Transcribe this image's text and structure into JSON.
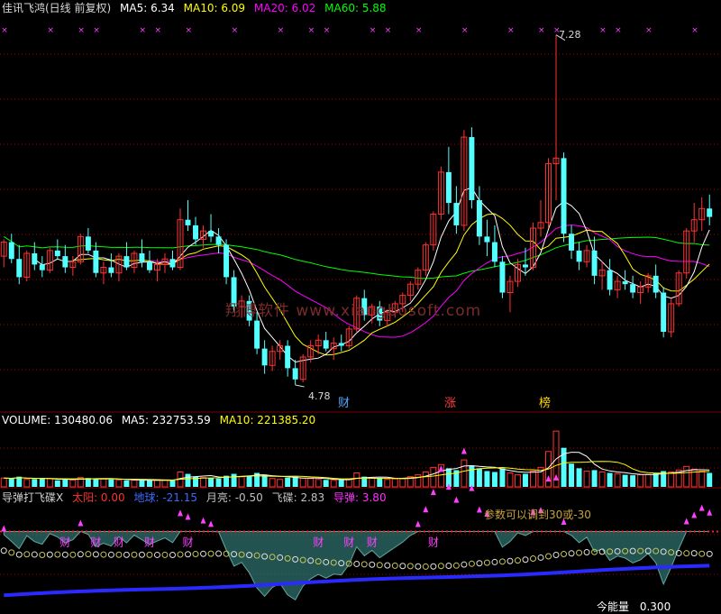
{
  "header": {
    "title": "佳讯飞鸿(日线 前复权)",
    "ma5": "MA5: 6.34",
    "ma10": "MA10: 6.09",
    "ma20": "MA20: 6.02",
    "ma60": "MA60: 5.88"
  },
  "volume_header": {
    "label": "VOLUME: 130480.06",
    "ma5": "MA5: 232753.59",
    "ma10": "MA10: 221385.20"
  },
  "indicator_header": {
    "name": "导弹打飞碟X",
    "sun": "太阳: 0.00",
    "earth": "地球: -21.15",
    "moon": "月亮: -0.50",
    "ufo": "飞碟: 2.83",
    "missile": "导弹: 3.80"
  },
  "annotations": {
    "high_price": "7.28",
    "low_price": "4.78",
    "badge_cai": "财",
    "badge_zhang": "涨",
    "badge_bang": "榜",
    "param_note": "参数可以调到30或-30",
    "energy_label": "今能量",
    "energy_value": "0.300",
    "watermark": "翔博软件 www.xiangbosoft.com",
    "cai_marker": "财"
  },
  "colors": {
    "up": "#ff3232",
    "down": "#54ffff",
    "ma5": "#ffffff",
    "ma10": "#ffff00",
    "ma20": "#ff00ff",
    "ma60": "#00ff00",
    "grid": "#b00000",
    "blue_line": "#2a2aff"
  },
  "chart_data": {
    "type": "candlestick",
    "price_range": [
      4.6,
      7.4
    ],
    "candles": [
      [
        5.7,
        5.82,
        5.62,
        5.8
      ],
      [
        5.8,
        5.86,
        5.65,
        5.68
      ],
      [
        5.68,
        5.78,
        5.5,
        5.55
      ],
      [
        5.55,
        5.74,
        5.52,
        5.72
      ],
      [
        5.72,
        5.8,
        5.6,
        5.64
      ],
      [
        5.64,
        5.7,
        5.55,
        5.6
      ],
      [
        5.6,
        5.76,
        5.58,
        5.74
      ],
      [
        5.74,
        5.82,
        5.68,
        5.7
      ],
      [
        5.7,
        5.78,
        5.58,
        5.62
      ],
      [
        5.62,
        5.7,
        5.56,
        5.66
      ],
      [
        5.66,
        5.86,
        5.64,
        5.84
      ],
      [
        5.84,
        5.9,
        5.72,
        5.74
      ],
      [
        5.74,
        5.8,
        5.55,
        5.58
      ],
      [
        5.58,
        5.66,
        5.5,
        5.62
      ],
      [
        5.62,
        5.72,
        5.55,
        5.58
      ],
      [
        5.58,
        5.72,
        5.52,
        5.7
      ],
      [
        5.7,
        5.8,
        5.6,
        5.62
      ],
      [
        5.62,
        5.74,
        5.58,
        5.72
      ],
      [
        5.72,
        5.82,
        5.62,
        5.66
      ],
      [
        5.66,
        5.74,
        5.58,
        5.6
      ],
      [
        5.6,
        5.68,
        5.52,
        5.64
      ],
      [
        5.64,
        5.72,
        5.58,
        5.68
      ],
      [
        5.68,
        5.74,
        5.6,
        5.62
      ],
      [
        5.62,
        6.04,
        5.6,
        5.96
      ],
      [
        5.96,
        6.1,
        5.88,
        5.92
      ],
      [
        5.92,
        5.98,
        5.78,
        5.82
      ],
      [
        5.82,
        5.92,
        5.76,
        5.88
      ],
      [
        5.88,
        6.0,
        5.8,
        5.84
      ],
      [
        5.84,
        5.9,
        5.72,
        5.78
      ],
      [
        5.78,
        5.82,
        5.5,
        5.55
      ],
      [
        5.55,
        5.6,
        5.3,
        5.34
      ],
      [
        5.34,
        5.42,
        5.26,
        5.38
      ],
      [
        5.38,
        5.42,
        5.2,
        5.24
      ],
      [
        5.24,
        5.3,
        5.0,
        5.04
      ],
      [
        5.04,
        5.1,
        4.86,
        4.92
      ],
      [
        4.92,
        5.06,
        4.88,
        5.02
      ],
      [
        5.02,
        5.1,
        4.96,
        5.06
      ],
      [
        5.06,
        5.1,
        4.84,
        4.9
      ],
      [
        4.9,
        4.96,
        4.78,
        4.82
      ],
      [
        4.82,
        5.0,
        4.8,
        4.98
      ],
      [
        4.98,
        5.1,
        4.94,
        5.06
      ],
      [
        5.06,
        5.14,
        5.0,
        5.1
      ],
      [
        5.1,
        5.16,
        5.02,
        5.04
      ],
      [
        5.04,
        5.12,
        4.96,
        5.08
      ],
      [
        5.08,
        5.14,
        5.02,
        5.06
      ],
      [
        5.06,
        5.2,
        5.04,
        5.18
      ],
      [
        5.18,
        5.42,
        5.16,
        5.4
      ],
      [
        5.4,
        5.46,
        5.24,
        5.28
      ],
      [
        5.28,
        5.36,
        5.22,
        5.34
      ],
      [
        5.34,
        5.38,
        5.2,
        5.24
      ],
      [
        5.24,
        5.32,
        5.2,
        5.3
      ],
      [
        5.3,
        5.38,
        5.26,
        5.36
      ],
      [
        5.36,
        5.44,
        5.3,
        5.42
      ],
      [
        5.42,
        5.52,
        5.38,
        5.5
      ],
      [
        5.5,
        5.62,
        5.46,
        5.6
      ],
      [
        5.6,
        5.8,
        5.56,
        5.78
      ],
      [
        5.78,
        6.02,
        5.74,
        6.0
      ],
      [
        6.0,
        6.34,
        5.96,
        6.3
      ],
      [
        6.3,
        6.48,
        6.0,
        6.08
      ],
      [
        6.08,
        6.2,
        5.86,
        5.92
      ],
      [
        5.92,
        6.6,
        5.88,
        6.55
      ],
      [
        6.55,
        6.62,
        6.04,
        6.1
      ],
      [
        6.1,
        6.2,
        5.78,
        5.84
      ],
      [
        5.84,
        5.96,
        5.7,
        5.8
      ],
      [
        5.8,
        5.92,
        5.62,
        5.66
      ],
      [
        5.66,
        5.7,
        5.4,
        5.44
      ],
      [
        5.44,
        5.56,
        5.3,
        5.52
      ],
      [
        5.52,
        5.68,
        5.48,
        5.64
      ],
      [
        5.64,
        5.76,
        5.56,
        5.62
      ],
      [
        5.62,
        5.94,
        5.6,
        5.9
      ],
      [
        5.9,
        6.1,
        5.84,
        5.94
      ],
      [
        5.94,
        6.4,
        5.9,
        6.36
      ],
      [
        6.36,
        7.28,
        6.1,
        6.4
      ],
      [
        6.4,
        6.44,
        5.8,
        5.86
      ],
      [
        5.86,
        5.92,
        5.68,
        5.74
      ],
      [
        5.74,
        5.8,
        5.6,
        5.66
      ],
      [
        5.66,
        5.78,
        5.62,
        5.74
      ],
      [
        5.74,
        5.84,
        5.5,
        5.56
      ],
      [
        5.56,
        5.66,
        5.46,
        5.6
      ],
      [
        5.6,
        5.68,
        5.42,
        5.46
      ],
      [
        5.46,
        5.56,
        5.4,
        5.52
      ],
      [
        5.52,
        5.6,
        5.46,
        5.5
      ],
      [
        5.5,
        5.56,
        5.4,
        5.44
      ],
      [
        5.44,
        5.52,
        5.36,
        5.48
      ],
      [
        5.48,
        5.58,
        5.44,
        5.56
      ],
      [
        5.56,
        5.64,
        5.4,
        5.44
      ],
      [
        5.44,
        5.48,
        5.12,
        5.16
      ],
      [
        5.16,
        5.4,
        5.12,
        5.36
      ],
      [
        5.36,
        5.6,
        5.34,
        5.58
      ],
      [
        5.58,
        5.9,
        5.54,
        5.88
      ],
      [
        5.88,
        6.08,
        5.8,
        5.96
      ],
      [
        5.96,
        6.12,
        5.88,
        6.04
      ],
      [
        6.04,
        6.14,
        5.92,
        5.98
      ]
    ],
    "volume_max": 640000,
    "volumes": [
      95000,
      90000,
      110000,
      80000,
      85000,
      90000,
      88000,
      70000,
      80000,
      75000,
      100000,
      95000,
      90000,
      85000,
      80000,
      75000,
      70000,
      72000,
      68000,
      70000,
      75000,
      72000,
      70000,
      160000,
      140000,
      110000,
      100000,
      95000,
      90000,
      120000,
      140000,
      110000,
      120000,
      150000,
      130000,
      90000,
      80000,
      100000,
      110000,
      95000,
      90000,
      80000,
      75000,
      70000,
      75000,
      85000,
      150000,
      110000,
      95000,
      90000,
      80000,
      85000,
      90000,
      110000,
      130000,
      160000,
      210000,
      240000,
      200000,
      180000,
      290000,
      230000,
      200000,
      170000,
      160000,
      200000,
      150000,
      130000,
      140000,
      170000,
      210000,
      380000,
      600000,
      420000,
      250000,
      200000,
      170000,
      180000,
      160000,
      150000,
      140000,
      130000,
      125000,
      130000,
      135000,
      150000,
      170000,
      160000,
      180000,
      220000,
      190000,
      170000,
      150000
    ],
    "indicator_range": [
      -30,
      10
    ]
  }
}
